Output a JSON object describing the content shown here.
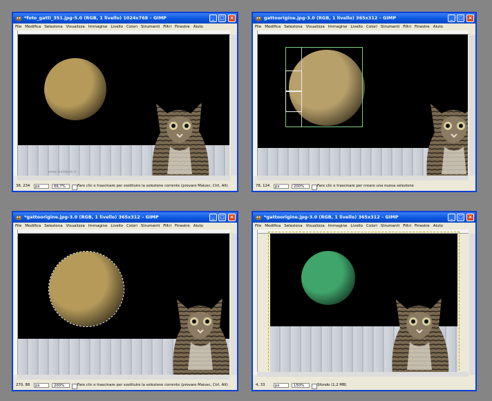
{
  "menu": [
    "File",
    "Modifica",
    "Seleziona",
    "Visualizza",
    "Immagine",
    "Livello",
    "Colori",
    "Strumenti",
    "Filtri",
    "Finestre",
    "Aiuto"
  ],
  "windows": [
    {
      "title": "*foto_gatti_351.jpg-5.0 (RGB, 1 livello) 1024x768 – GIMP",
      "coords": "38, 234",
      "unit": "px",
      "zoom": "66,7%",
      "status": "Fare clic e trascinare per sostituire la selezione corrente (provare Maiusc, Ctrl, Alt)",
      "watermark": "www.waldweb.it",
      "moon_color": "#b59a5a"
    },
    {
      "title": "gattoorigine.jpg-3.0 (RGB, 1 livello) 365x312 – GIMP",
      "coords": "78, 124",
      "unit": "px",
      "zoom": "200%",
      "status": "Fare clic e trascinare per creare una nuova selezione",
      "moon_color": "#b8a06a"
    },
    {
      "title": "*gattoorigine.jpg-3.0 (RGB, 1 livello) 365x312 – GIMP",
      "coords": "270, 88",
      "unit": "px",
      "zoom": "200%",
      "status": "Fare clic e trascinare per sostituire la selezione corrente (provare Maiusc, Ctrl, Alt)",
      "moon_color": "#b59a5a"
    },
    {
      "title": "*gattoorigine.jpg-3.0 (RGB, 1 livello) 365x312 – GIMP",
      "coords": "4, 33",
      "unit": "px",
      "zoom": "150%",
      "status": "Sfondo (1,2 MB)",
      "moon_color": "#3fa56a"
    }
  ]
}
